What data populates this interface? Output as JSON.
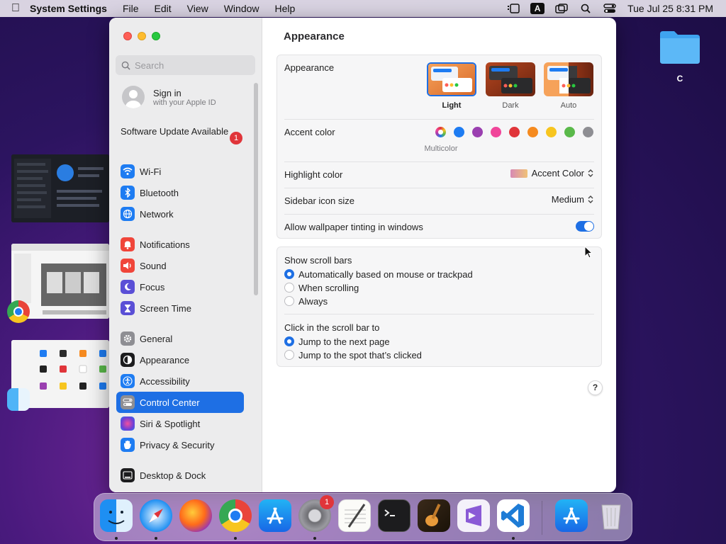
{
  "menubar": {
    "app_name": "System Settings",
    "menus": [
      "File",
      "Edit",
      "View",
      "Window",
      "Help"
    ],
    "clock": "Tue Jul 25  8:31 PM",
    "icons": [
      "stage-manager-icon",
      "input-source-icon",
      "screen-mirroring-icon",
      "spotlight-search-icon",
      "control-center-icon"
    ],
    "input_source_letter": "A"
  },
  "desktop": {
    "folder_label": "C"
  },
  "sidebar": {
    "search_placeholder": "Search",
    "signin_title": "Sign in",
    "signin_subtitle": "with your Apple ID",
    "update_label": "Software Update Available",
    "update_badge": "1",
    "items": [
      {
        "label": "Wi-Fi",
        "icon": "wifi-icon",
        "color": "#1e7cf2"
      },
      {
        "label": "Bluetooth",
        "icon": "bluetooth-icon",
        "color": "#1e7cf2"
      },
      {
        "label": "Network",
        "icon": "globe-icon",
        "color": "#1e7cf2"
      },
      {
        "label": "Notifications",
        "icon": "bell-icon",
        "color": "#f0453a"
      },
      {
        "label": "Sound",
        "icon": "speaker-icon",
        "color": "#f0453a"
      },
      {
        "label": "Focus",
        "icon": "moon-icon",
        "color": "#5a4fd6"
      },
      {
        "label": "Screen Time",
        "icon": "hourglass-icon",
        "color": "#5a4fd6"
      },
      {
        "label": "General",
        "icon": "gear-icon",
        "color": "#8e8e93"
      },
      {
        "label": "Appearance",
        "icon": "appearance-icon",
        "color": "#1c1c1e"
      },
      {
        "label": "Accessibility",
        "icon": "accessibility-icon",
        "color": "#1e7cf2"
      },
      {
        "label": "Control Center",
        "icon": "control-center-icon",
        "color": "#8e8e93"
      },
      {
        "label": "Siri & Spotlight",
        "icon": "siri-icon",
        "color": "#b04fd6"
      },
      {
        "label": "Privacy & Security",
        "icon": "hand-icon",
        "color": "#1e7cf2"
      },
      {
        "label": "Desktop & Dock",
        "icon": "dock-icon",
        "color": "#1c1c1e"
      }
    ],
    "selected": "Control Center"
  },
  "main": {
    "title": "Appearance",
    "appearance": {
      "label": "Appearance",
      "options": [
        "Light",
        "Dark",
        "Auto"
      ],
      "selected": "Light"
    },
    "accent": {
      "label": "Accent color",
      "colors": [
        "multicolor",
        "#1e7cf2",
        "#9a3fb0",
        "#f0459a",
        "#e0353a",
        "#f58a1f",
        "#f7c51f",
        "#5ab94a",
        "#8e8e93"
      ],
      "caption": "Multicolor"
    },
    "highlight": {
      "label": "Highlight color",
      "value": "Accent Color"
    },
    "icon_size": {
      "label": "Sidebar icon size",
      "value": "Medium"
    },
    "tinting": {
      "label": "Allow wallpaper tinting in windows",
      "on": true
    },
    "scroll_bars": {
      "label": "Show scroll bars",
      "options": [
        "Automatically based on mouse or trackpad",
        "When scrolling",
        "Always"
      ],
      "selected": 0
    },
    "click_scroll": {
      "label": "Click in the scroll bar to",
      "options": [
        "Jump to the next page",
        "Jump to the spot that’s clicked"
      ],
      "selected": 0
    },
    "help": "?"
  },
  "dock": {
    "apps": [
      "Finder",
      "Safari",
      "Firefox",
      "Chrome",
      "App Store",
      "System Settings",
      "TextEdit",
      "Terminal",
      "GarageBand",
      "Visual Studio",
      "VS Code",
      "App Store Downloads",
      "Trash"
    ],
    "settings_badge": "1"
  }
}
